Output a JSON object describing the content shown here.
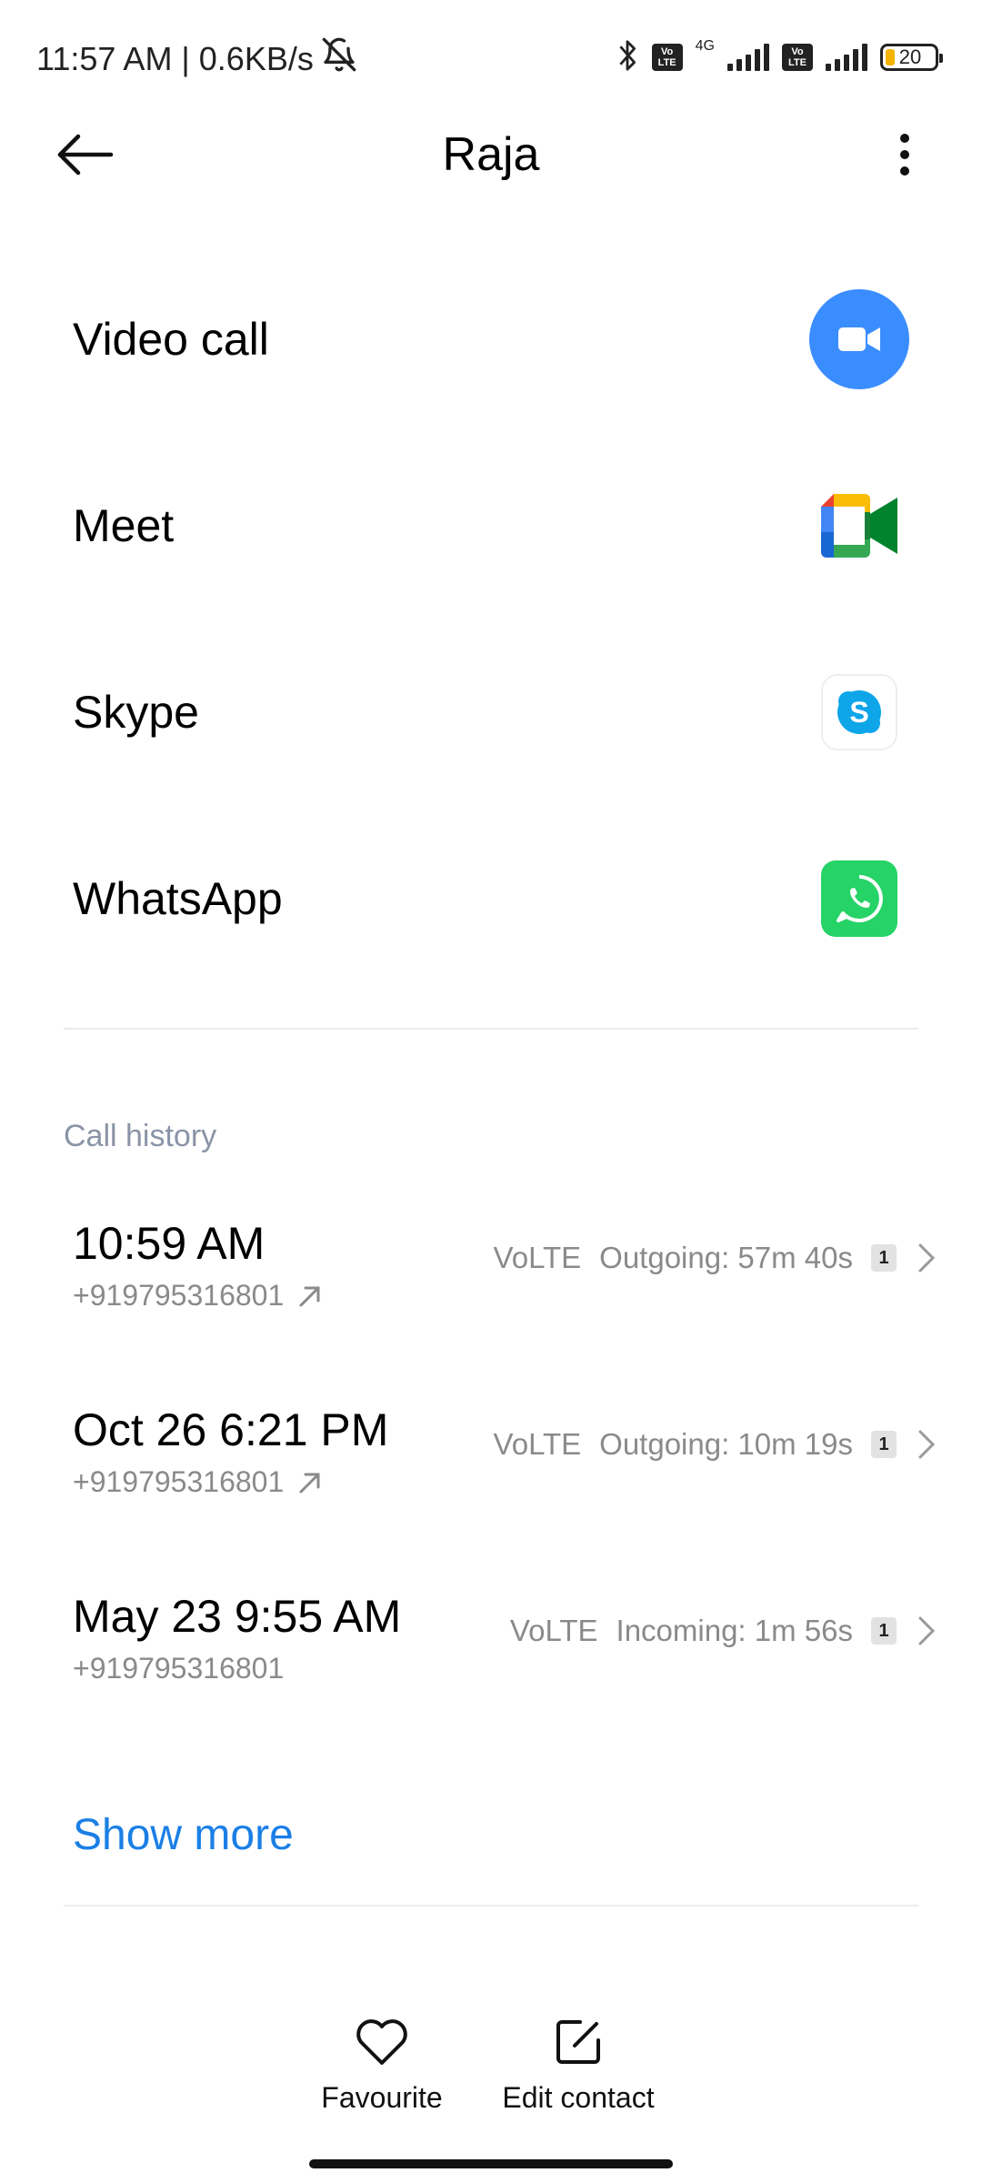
{
  "status_bar": {
    "time_speed": "11:57 AM | 0.6KB/s",
    "volte_1": "Vo LTE",
    "network_type": "4G",
    "volte_2": "Vo LTE",
    "battery_level": "20",
    "battery_fraction": 0.2,
    "battery_color": "#f3b300"
  },
  "header": {
    "title": "Raja"
  },
  "apps": [
    {
      "label": "Video call",
      "icon": "video-camera-icon",
      "color": "#3a8dff"
    },
    {
      "label": "Meet",
      "icon": "google-meet-icon"
    },
    {
      "label": "Skype",
      "icon": "skype-icon",
      "color": "#0ea5e9"
    },
    {
      "label": "WhatsApp",
      "icon": "whatsapp-icon",
      "color": "#25d366"
    }
  ],
  "call_history": {
    "title": "Call history",
    "entries": [
      {
        "time": "10:59 AM",
        "number": "+919795316801",
        "direction_icon": "outgoing-arrow-icon",
        "network": "VoLTE",
        "detail": "Outgoing: 57m 40s",
        "sim": "1"
      },
      {
        "time": "Oct 26 6:21 PM",
        "number": "+919795316801",
        "direction_icon": "outgoing-arrow-icon",
        "network": "VoLTE",
        "detail": "Outgoing: 10m 19s",
        "sim": "1"
      },
      {
        "time": "May 23 9:55 AM",
        "number": "+919795316801",
        "direction_icon": "",
        "network": "VoLTE",
        "detail": "Incoming: 1m 56s",
        "sim": "1"
      }
    ],
    "show_more": "Show more"
  },
  "bottom_actions": {
    "favourite": "Favourite",
    "edit_contact": "Edit contact"
  },
  "colors": {
    "accent": "#1a7fe6",
    "secondary_text": "#8a8a8a",
    "section_title": "#8a94a6"
  }
}
